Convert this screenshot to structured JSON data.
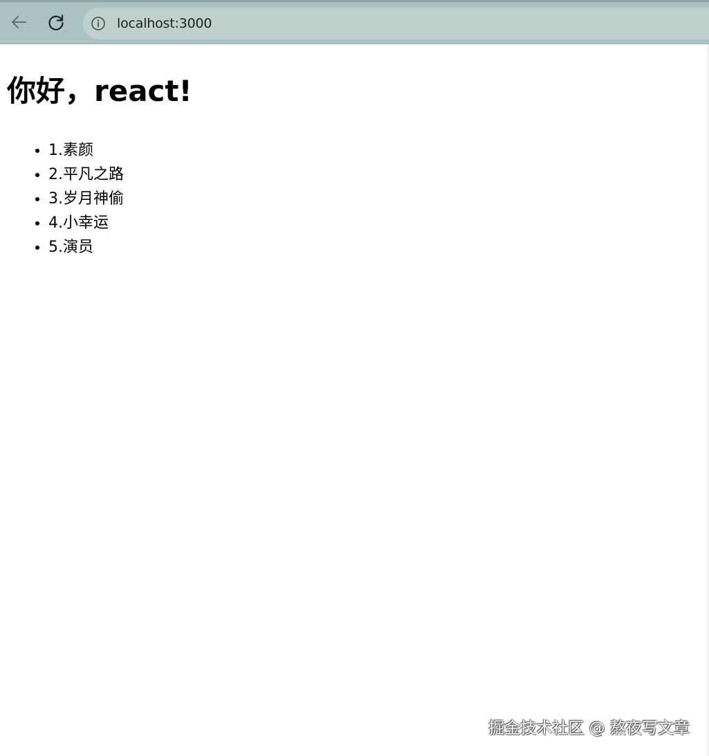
{
  "browser": {
    "url": "localhost:3000",
    "back_icon": "arrow-left-icon",
    "reload_icon": "reload-icon",
    "info_icon": "info-circle-icon"
  },
  "page": {
    "heading": "你好，react!",
    "songs": [
      "1.素颜",
      "2.平凡之路",
      "3.岁月神偷",
      "4.小幸运",
      "5.演员"
    ]
  },
  "watermark": "掘金技术社区 @ 熬夜写文章",
  "colors": {
    "toolbar": "#a9c4bf",
    "addressbar": "#bfd1cd",
    "page_bg": "#ffffff"
  }
}
